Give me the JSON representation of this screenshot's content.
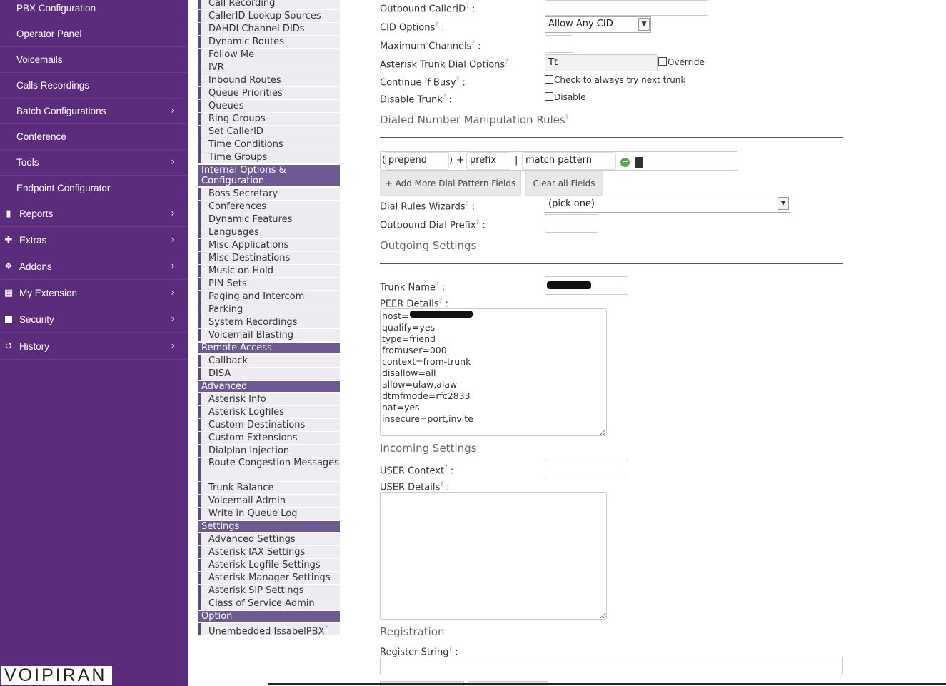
{
  "leftnav": {
    "items": [
      {
        "label": "PBX Configuration",
        "type": "sub",
        "chevron": false
      },
      {
        "label": "Operator Panel",
        "type": "sub",
        "chevron": false
      },
      {
        "label": "Voicemails",
        "type": "sub",
        "chevron": false
      },
      {
        "label": "Calls Recordings",
        "type": "sub",
        "chevron": false
      },
      {
        "label": "Batch Configurations",
        "type": "sub",
        "chevron": true
      },
      {
        "label": "Conference",
        "type": "sub",
        "chevron": false
      },
      {
        "label": "Tools",
        "type": "sub",
        "chevron": true
      },
      {
        "label": "Endpoint Configurator",
        "type": "sub",
        "chevron": false
      },
      {
        "label": "Reports",
        "type": "top",
        "icon": "bar-chart-icon",
        "chevron": true
      },
      {
        "label": "Extras",
        "type": "top",
        "icon": "plus-icon",
        "chevron": true
      },
      {
        "label": "Addons",
        "type": "top",
        "icon": "cubes-icon",
        "chevron": true
      },
      {
        "label": "My Extension",
        "type": "top",
        "icon": "calculator-icon",
        "chevron": true
      },
      {
        "label": "Security",
        "type": "top",
        "icon": "lock-icon",
        "chevron": true
      },
      {
        "label": "History",
        "type": "top",
        "icon": "history-icon",
        "chevron": true
      }
    ],
    "logo": "VOIPIRAN"
  },
  "modmenu": {
    "items": [
      {
        "t": "item",
        "label": "Call Recording"
      },
      {
        "t": "item",
        "label": "CallerID Lookup Sources"
      },
      {
        "t": "item",
        "label": "DAHDI Channel DIDs"
      },
      {
        "t": "item",
        "label": "Dynamic Routes"
      },
      {
        "t": "item",
        "label": "Follow Me"
      },
      {
        "t": "item",
        "label": "IVR"
      },
      {
        "t": "item",
        "label": "Inbound Routes"
      },
      {
        "t": "item",
        "label": "Queue Priorities"
      },
      {
        "t": "item",
        "label": "Queues"
      },
      {
        "t": "item",
        "label": "Ring Groups"
      },
      {
        "t": "item",
        "label": "Set CallerID"
      },
      {
        "t": "item",
        "label": "Time Conditions"
      },
      {
        "t": "item",
        "label": "Time Groups"
      },
      {
        "t": "head",
        "label": "Internal Options & Configuration",
        "two": true
      },
      {
        "t": "item",
        "label": "Boss Secretary"
      },
      {
        "t": "item",
        "label": "Conferences"
      },
      {
        "t": "item",
        "label": "Dynamic Features"
      },
      {
        "t": "item",
        "label": "Languages"
      },
      {
        "t": "item",
        "label": "Misc Applications"
      },
      {
        "t": "item",
        "label": "Misc Destinations"
      },
      {
        "t": "item",
        "label": "Music on Hold"
      },
      {
        "t": "item",
        "label": "PIN Sets"
      },
      {
        "t": "item",
        "label": "Paging and Intercom"
      },
      {
        "t": "item",
        "label": "Parking"
      },
      {
        "t": "item",
        "label": "System Recordings"
      },
      {
        "t": "item",
        "label": "Voicemail Blasting"
      },
      {
        "t": "head",
        "label": "Remote Access"
      },
      {
        "t": "item",
        "label": "Callback"
      },
      {
        "t": "item",
        "label": "DISA"
      },
      {
        "t": "head",
        "label": "Advanced"
      },
      {
        "t": "item",
        "label": "Asterisk Info"
      },
      {
        "t": "item",
        "label": "Asterisk Logfiles"
      },
      {
        "t": "item",
        "label": "Custom Destinations"
      },
      {
        "t": "item",
        "label": "Custom Extensions"
      },
      {
        "t": "item",
        "label": "Dialplan Injection"
      },
      {
        "t": "item",
        "label": "Route Congestion Messages",
        "two": true
      },
      {
        "t": "item",
        "label": "Trunk Balance"
      },
      {
        "t": "item",
        "label": "Voicemail Admin"
      },
      {
        "t": "item",
        "label": "Write in Queue Log"
      },
      {
        "t": "head",
        "label": "Settings"
      },
      {
        "t": "item",
        "label": "Advanced Settings"
      },
      {
        "t": "item",
        "label": "Asterisk IAX Settings"
      },
      {
        "t": "item",
        "label": "Asterisk Logfile Settings"
      },
      {
        "t": "item",
        "label": "Asterisk Manager Settings"
      },
      {
        "t": "item",
        "label": "Asterisk SIP Settings"
      },
      {
        "t": "item",
        "label": "Class of Service Admin"
      },
      {
        "t": "head",
        "label": "Option"
      },
      {
        "t": "item",
        "label": "Unembedded IssabelPBX",
        "help": true
      }
    ]
  },
  "form": {
    "outbound_callerid_label": "Outbound CallerID",
    "cid_options_label": "CID Options",
    "cid_options_value": "Allow Any CID",
    "max_channels_label": "Maximum Channels",
    "trunk_dial_options_label": "Asterisk Trunk Dial Options",
    "trunk_dial_options_value": "Tt",
    "override_label": "Override",
    "continue_busy_label": "Continue if Busy",
    "continue_busy_check": "Check to always try next trunk",
    "disable_trunk_label": "Disable Trunk",
    "disable_check": "Disable",
    "dial_rules_section": "Dialed Number Manipulation Rules",
    "prepend_placeholder": "prepend",
    "prefix_placeholder": "prefix",
    "match_placeholder": "match pattern",
    "paren_open": "(",
    "paren_close": ")",
    "plus": "+",
    "pipe": "|",
    "add_more_button": "+ Add More Dial Pattern Fields",
    "clear_all_button": "Clear all Fields",
    "dial_wizard_label": "Dial Rules Wizards",
    "dial_wizard_value": "(pick one)",
    "outbound_prefix_label": "Outbound Dial Prefix",
    "outgoing_section": "Outgoing Settings",
    "trunk_name_label": "Trunk Name",
    "peer_details_label": "PEER Details",
    "peer_details_value": "host=\nqualify=yes\ntype=friend\nfromuser=000\ncontext=from-trunk\ndisallow=all\nallow=ulaw,alaw\ndtmfmode=rfc2833\nnat=yes\ninsecure=port,invite",
    "incoming_section": "Incoming Settings",
    "user_context_label": "USER Context",
    "user_details_label": "USER Details",
    "registration_section": "Registration",
    "register_string_label": "Register String",
    "colon": ":",
    "help_glyph": "?"
  }
}
